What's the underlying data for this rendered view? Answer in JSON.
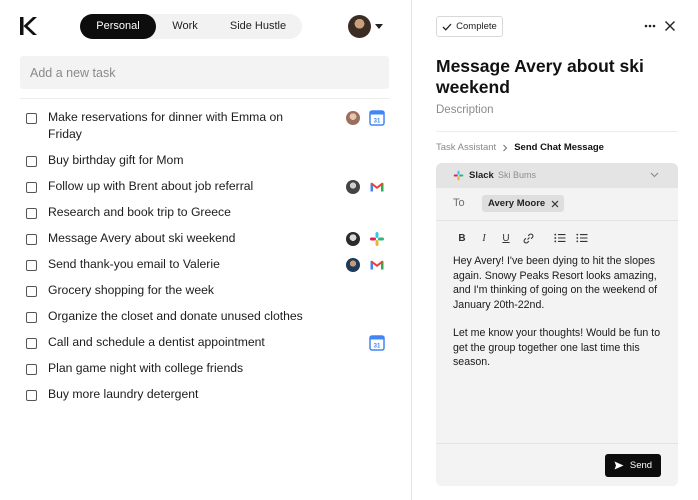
{
  "app": {
    "logo_icon": "k-logo-icon"
  },
  "tabs": [
    {
      "label": "Personal",
      "active": true
    },
    {
      "label": "Work",
      "active": false
    },
    {
      "label": "Side Hustle",
      "active": false
    }
  ],
  "new_task": {
    "placeholder": "Add a new task"
  },
  "tasks": [
    {
      "text": "Make reservations for dinner with Emma on Friday",
      "avatar": true,
      "app": "google-calendar-icon"
    },
    {
      "text": "Buy birthday gift for Mom"
    },
    {
      "text": "Follow up with Brent about job referral",
      "avatar": true,
      "app": "gmail-icon"
    },
    {
      "text": "Research and book trip to Greece"
    },
    {
      "text": "Message Avery about ski weekend",
      "avatar": true,
      "app": "slack-icon"
    },
    {
      "text": "Send thank-you email to Valerie",
      "avatar": true,
      "app": "gmail-icon"
    },
    {
      "text": "Grocery shopping for the week"
    },
    {
      "text": "Organize the closet and donate unused clothes"
    },
    {
      "text": "Call and schedule a dentist appointment",
      "app": "google-calendar-icon"
    },
    {
      "text": "Plan game night with college friends"
    },
    {
      "text": "Buy more laundry detergent"
    }
  ],
  "detail": {
    "complete_label": "Complete",
    "title": "Message Avery about ski weekend",
    "description_placeholder": "Description",
    "breadcrumb": {
      "parent": "Task Assistant",
      "current": "Send Chat Message"
    }
  },
  "composer": {
    "app_name": "Slack",
    "workspace": "Ski Bums",
    "to_label": "To",
    "recipient": "Avery Moore",
    "toolbar": [
      "bold",
      "italic",
      "underline",
      "link",
      "ordered-list",
      "bulleted-list"
    ],
    "toolbar_glyphs": {
      "bold": "B",
      "italic": "I",
      "underline": "U"
    },
    "message": {
      "p1": "Hey Avery! I've been dying to hit the slopes again. Snowy Peaks Resort looks amazing, and I'm thinking of going on the weekend of January 20th-22nd.",
      "p2": "Let me know your thoughts! Would be fun to get the group together one last time this season."
    },
    "send_label": "Send"
  },
  "colors": {
    "accent": "#0d0d0d",
    "gmail_red": "#ea4335",
    "calendar_blue": "#4285f4",
    "slack_green": "#2eb67d"
  }
}
